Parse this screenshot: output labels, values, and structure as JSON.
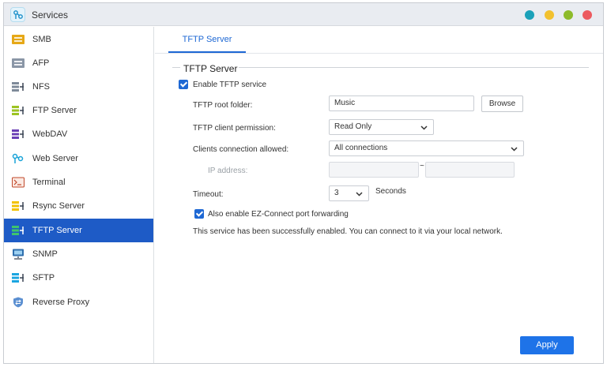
{
  "window": {
    "title": "Services"
  },
  "colors": {
    "accent": "#1e68d4",
    "sidebar_active": "#1e5bc6",
    "apply_button": "#1e73e8",
    "win_btn_teal": "#1aa1b9",
    "win_btn_yellow": "#f2c12e",
    "win_btn_green": "#8dbb2a",
    "win_btn_red": "#ec5a5f"
  },
  "sidebar": {
    "items": [
      {
        "label": "SMB",
        "icon": "smb-icon"
      },
      {
        "label": "AFP",
        "icon": "afp-icon"
      },
      {
        "label": "NFS",
        "icon": "nfs-icon"
      },
      {
        "label": "FTP Server",
        "icon": "ftp-server-icon"
      },
      {
        "label": "WebDAV",
        "icon": "webdav-icon"
      },
      {
        "label": "Web Server",
        "icon": "web-server-icon"
      },
      {
        "label": "Terminal",
        "icon": "terminal-icon"
      },
      {
        "label": "Rsync Server",
        "icon": "rsync-server-icon"
      },
      {
        "label": "TFTP Server",
        "icon": "tftp-server-icon",
        "active": true
      },
      {
        "label": "SNMP",
        "icon": "snmp-icon"
      },
      {
        "label": "SFTP",
        "icon": "sftp-icon"
      },
      {
        "label": "Reverse Proxy",
        "icon": "reverse-proxy-icon"
      }
    ]
  },
  "main": {
    "tab_label": "TFTP Server",
    "section_title": "TFTP Server",
    "enable_label": "Enable TFTP service",
    "enable_checked": true,
    "root_folder_label": "TFTP root folder:",
    "root_folder_value": "Music",
    "browse_label": "Browse",
    "permission_label": "TFTP client permission:",
    "permission_value": "Read Only",
    "clients_label": "Clients connection allowed:",
    "clients_value": "All connections",
    "ip_label": "IP address:",
    "ip_separator": "~",
    "timeout_label": "Timeout:",
    "timeout_value": "3",
    "timeout_unit": "Seconds",
    "ezconnect_label": "Also enable EZ-Connect port forwarding",
    "ezconnect_checked": true,
    "status_message": "This service has been successfully enabled. You can connect to it via your local network.",
    "apply_label": "Apply"
  }
}
